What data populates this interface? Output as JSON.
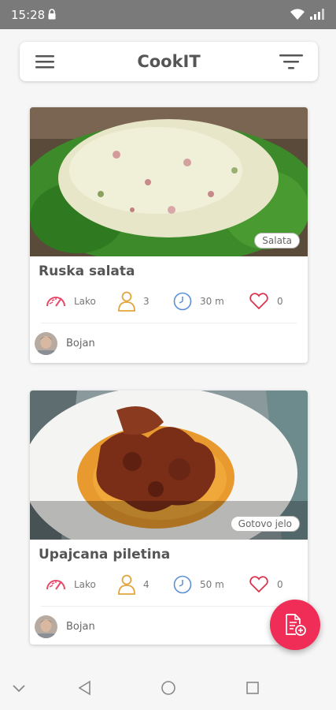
{
  "status_bar": {
    "time": "15:28",
    "icons": [
      "lock-icon",
      "wifi-icon",
      "signal-icon"
    ]
  },
  "app_bar": {
    "title": "CookIT",
    "icons": [
      "menu-icon",
      "filter-icon"
    ]
  },
  "recipes": [
    {
      "title": "Ruska salata",
      "category": "Salata",
      "difficulty": "Lako",
      "servings": "3",
      "time": "30 m",
      "likes": "0",
      "author": "Bojan"
    },
    {
      "title": "Upajcana piletina",
      "category": "Gotovo jelo",
      "difficulty": "Lako",
      "servings": "4",
      "time": "50 m",
      "likes": "0",
      "author": "Bojan"
    }
  ],
  "fab": {
    "icon": "add-recipe-icon"
  },
  "nav_bar": {
    "icons": [
      "nav-down-icon",
      "back-icon",
      "home-icon",
      "recents-icon"
    ]
  },
  "colors": {
    "accent": "#ef2d56",
    "status_bar": "#7a7a7a",
    "difficulty_icon": "#e64b6b",
    "servings_icon": "#e2a53d",
    "time_icon": "#5b8fd6",
    "likes_icon": "#d8344f"
  }
}
